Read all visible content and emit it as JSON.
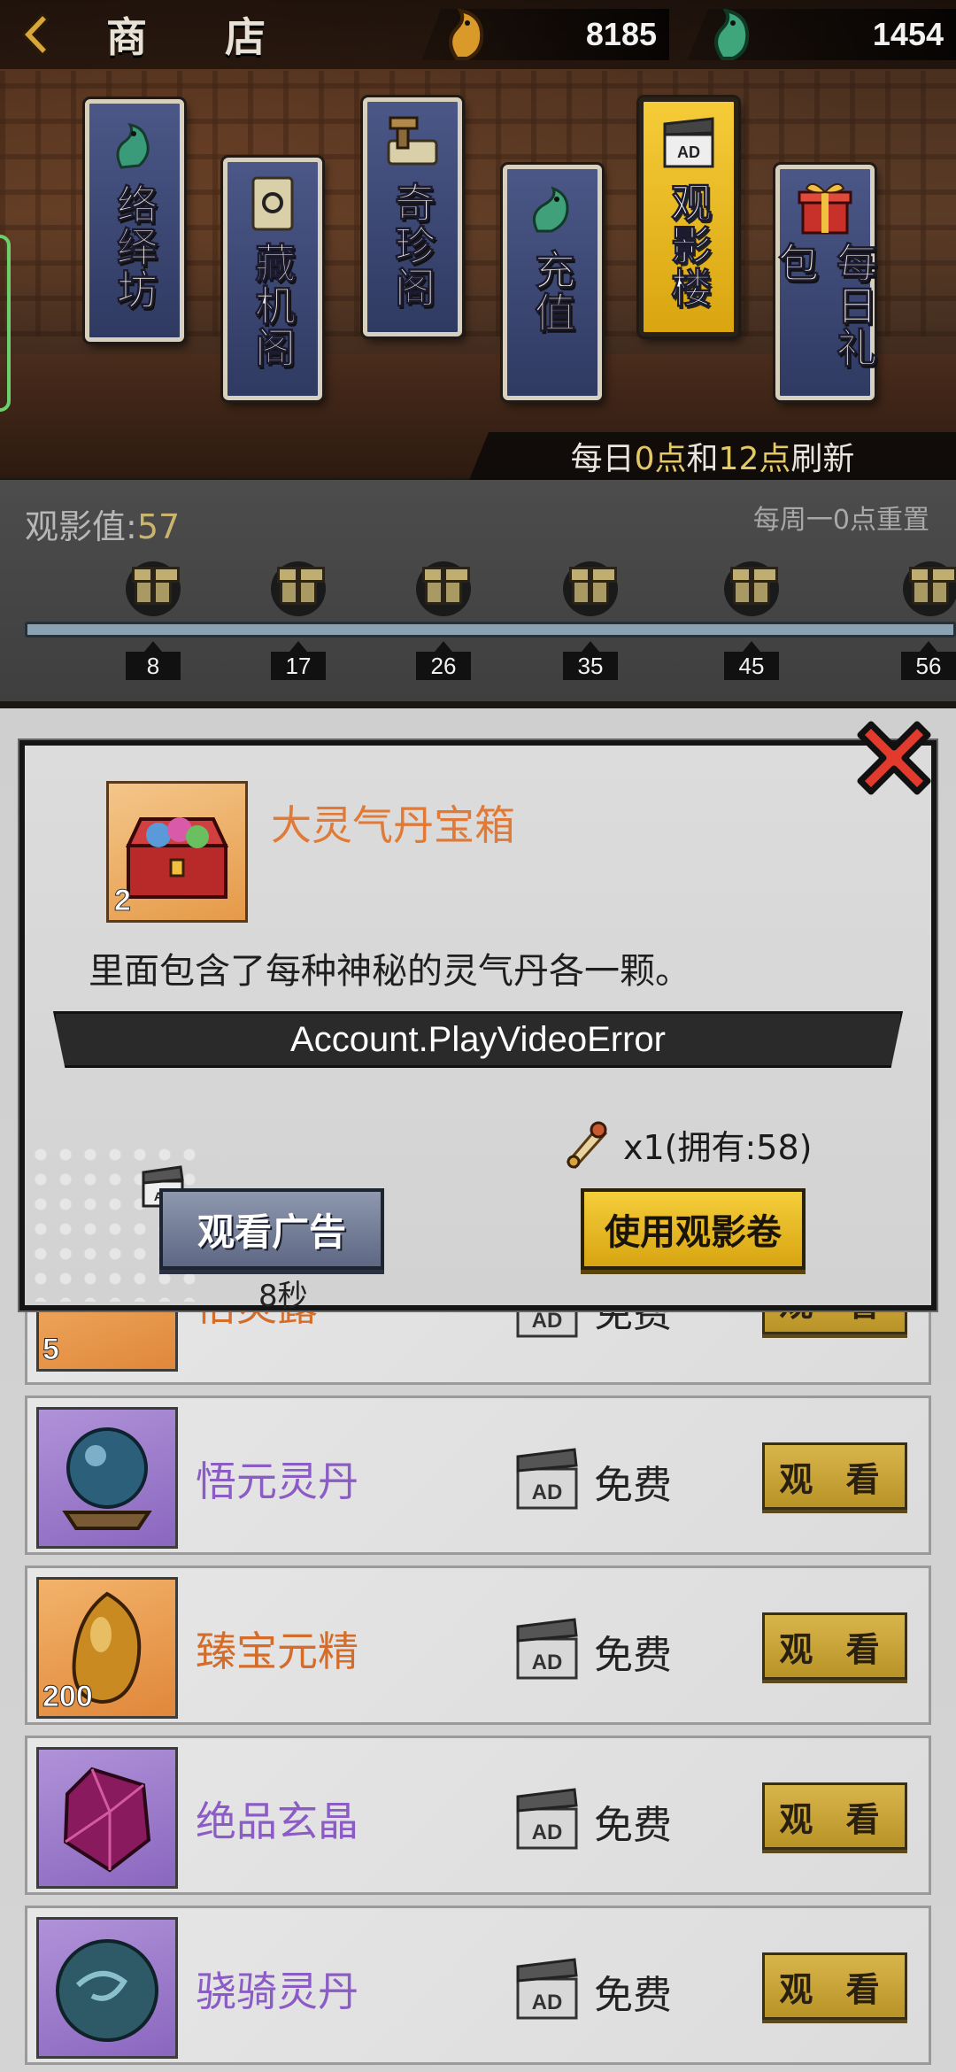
{
  "header": {
    "title": "商 店",
    "currency_1": {
      "icon": "gold-dragon-coin-icon",
      "amount": "8185"
    },
    "currency_2": {
      "icon": "jade-dragon-coin-icon",
      "amount": "1454"
    }
  },
  "banners": [
    {
      "label": "络绎坊",
      "icon": "jade-dragon-icon",
      "style": "blue"
    },
    {
      "label": "藏机阁",
      "icon": "scroll-icon",
      "style": "blue"
    },
    {
      "label": "奇珍阁",
      "icon": "hammer-scroll-icon",
      "style": "blue"
    },
    {
      "label": "充值",
      "icon": "green-dragon-coin-icon",
      "style": "blue"
    },
    {
      "label": "观影楼",
      "icon": "ad-clapper-icon",
      "style": "gold"
    },
    {
      "label": "每日礼包",
      "icon": "gift-box-icon",
      "style": "blue"
    }
  ],
  "refresh": {
    "prefix": "每日",
    "h1": "0点",
    "mid": "和",
    "h2": "12点",
    "suffix": "刷新"
  },
  "view_value": {
    "label": "观影值:",
    "value": "57",
    "weekly_reset": "每周一0点重置",
    "milestones": [
      "8",
      "17",
      "26",
      "35",
      "45",
      "56"
    ]
  },
  "list": {
    "items": [
      {
        "name": "悟元灵丹",
        "rarity": "purple",
        "icon": "crystal-orb-icon",
        "qty": "",
        "price": "免费",
        "action": "观 看"
      },
      {
        "name": "臻宝元精",
        "rarity": "orange",
        "icon": "amber-stone-icon",
        "qty": "200",
        "price": "免费",
        "action": "观 看"
      },
      {
        "name": "绝品玄晶",
        "rarity": "purple",
        "icon": "purple-gem-icon",
        "qty": "",
        "price": "免费",
        "action": "观 看"
      },
      {
        "name": "骁骑灵丹",
        "rarity": "purple",
        "icon": "teal-pill-icon",
        "qty": "",
        "price": "免费",
        "action": "观 看"
      }
    ],
    "hidden_row": {
      "name": "悟灵露",
      "qty": "5",
      "price": "免费",
      "action": "观 看"
    }
  },
  "modal": {
    "item_name": "大灵气丹宝箱",
    "item_qty": "2",
    "item_icon": "treasure-chest-icon",
    "description": "里面包含了每种神秘的灵气丹各一颗。",
    "error_text": "Account.PlayVideoError",
    "ticket_cost": "x1(拥有:58)",
    "watch_ad_label": "观看广告",
    "countdown": "8秒",
    "use_ticket_label": "使用观影卷"
  },
  "colors": {
    "accent_gold": "#d9a510",
    "rarity_purple": "#8b5bc6",
    "rarity_orange": "#d46c2a",
    "banner_blue": "#3b4674"
  }
}
